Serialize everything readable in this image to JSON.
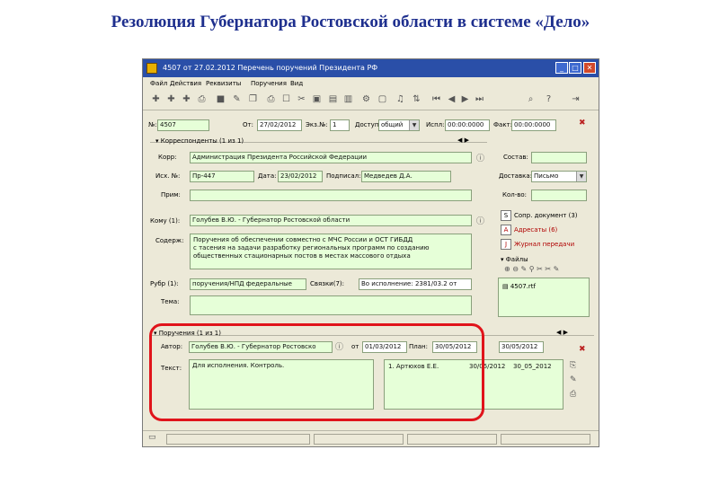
{
  "slide": {
    "title": "Резолюция Губернатора Ростовской области в системе «Дело»"
  },
  "window": {
    "title": "4507 от 27.02.2012 Перечень поручений Президента РФ",
    "controls": [
      "_",
      "□",
      "✕"
    ]
  },
  "menu": [
    "Файл",
    "Действия",
    "Реквизиты",
    "Поручения",
    "Вид"
  ],
  "header_row": {
    "number_label": "№:",
    "number_value": "4507",
    "date_label": "От:",
    "date_value": "27/02/2012",
    "copies_label": "Экз.№:",
    "copies_value": "1",
    "access_label": "Доступ:",
    "access_value": "общий",
    "ispl_label": "Испл:",
    "ispl_value": "00:00:0000",
    "fact_label": "Факт:",
    "fact_value": "00:00:0000"
  },
  "correspondents": {
    "header": "Корреспонденты (1 из 1)",
    "korr_label": "Корр:",
    "korr_value": "Администрация Президента Российской Федерации",
    "outnum_label": "Исх. №:",
    "outnum_value": "Пр-447",
    "date_label": "Дата:",
    "date_value": "23/02/2012",
    "signed_label": "Подписал:",
    "signed_value": "Медведев Д.А.",
    "note_label": "Прим:"
  },
  "side": {
    "sostav_label": "Состав:",
    "delivery_label": "Доставка:",
    "delivery_value": "Письмо",
    "pages_label": "Кол-во:",
    "buttons": [
      {
        "label": "Сопр. документ (3)",
        "icon": "S"
      },
      {
        "label": "Адресаты (6)",
        "icon": "A"
      },
      {
        "label": "Журнал передачи",
        "icon": "J"
      }
    ],
    "files_header": "Файлы",
    "file_name": "4507.rtf"
  },
  "komu": {
    "label": "Кому (1):",
    "value": "Голубев В.Ю. - Губернатор Ростовской области"
  },
  "content": {
    "label": "Содерж:",
    "lines": [
      "Поручения об обеспечении совместно с МЧС России и ОСТ ГИБДД",
      "с тасения на задачи разработку региональных программ по созданию",
      "общественных стационарных постов в местах массового отдыха"
    ]
  },
  "rubric": {
    "label": "Рубр (1):",
    "value": "поручения/НПД федеральные",
    "links_label": "Связки(7):",
    "links_value": "Во исполнение: 2381/03.2 от"
  },
  "theme_label": "Тема:",
  "assignment": {
    "header": "Поручения (1 из 1)",
    "author_label": "Автор:",
    "author_value": "Голубев В.Ю. - Губернатор Ростовско",
    "from_label": "от",
    "from_value": "01/03/2012",
    "plan_label": "План:",
    "plan_value": "30/05/2012",
    "fact_value": "30/05/2012",
    "text_label": "Текст:",
    "text_value": "Для исполнения. Контроль.",
    "executor_value": "1. Артюхов Е.Е.",
    "executor_date_1": "30/05/2012",
    "executor_date_2": "30_05_2012"
  }
}
